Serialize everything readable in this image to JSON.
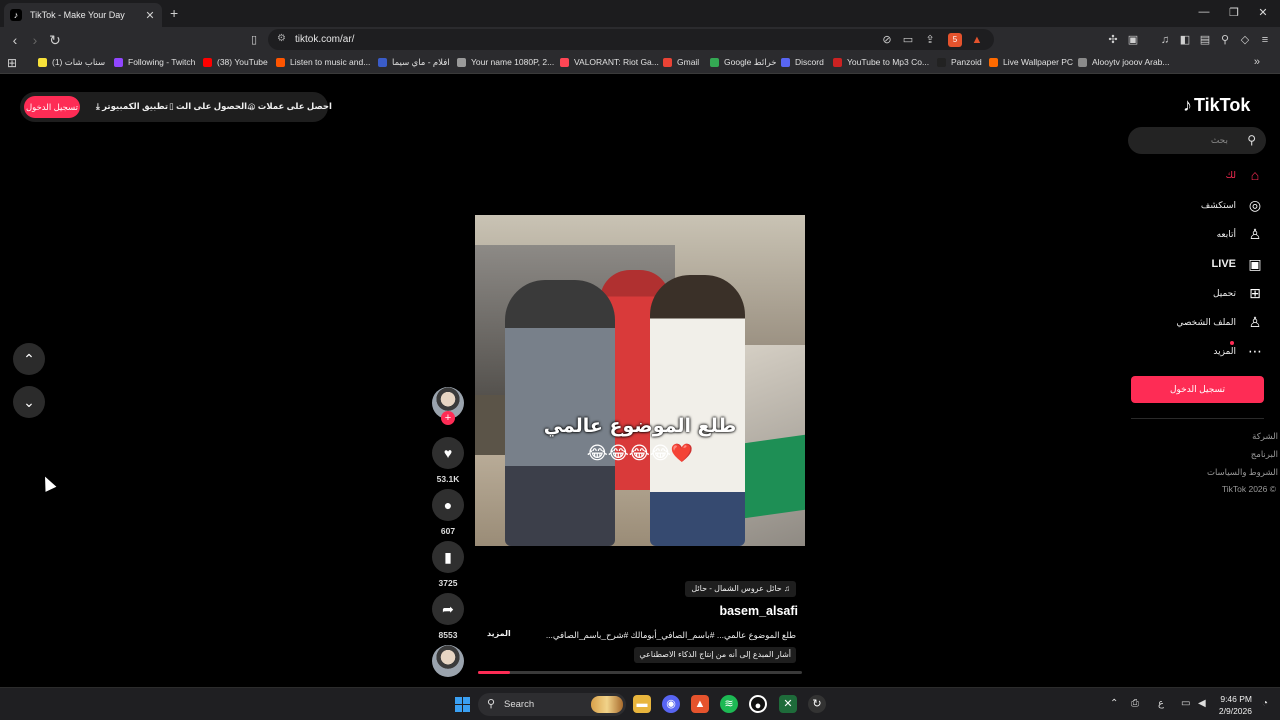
{
  "browser": {
    "tab_title": "TikTok - Make Your Day",
    "tab_close": "✕",
    "new_tab": "+",
    "url": "tiktok.com/ar/",
    "window_controls": {
      "minimize": "—",
      "restore": "❐",
      "close": "✕"
    },
    "shield_badge": "5"
  },
  "bookmarks": [
    {
      "label": "(1) سناب شات",
      "color": "#f7e13a"
    },
    {
      "label": "Following - Twitch",
      "color": "#9146ff"
    },
    {
      "label": "(38) YouTube",
      "color": "#ff0000"
    },
    {
      "label": "Listen to music and...",
      "color": "#ff5500"
    },
    {
      "label": "افلام - ماي سيما",
      "color": "#3a5cc8"
    },
    {
      "label": "Your name 1080P, 2...",
      "color": "#9a9a9a"
    },
    {
      "label": "VALORANT: Riot Ga...",
      "color": "#ff4655"
    },
    {
      "label": "Gmail",
      "color": "#ea4335"
    },
    {
      "label": "Google خرائط",
      "color": "#34a853"
    },
    {
      "label": "Discord",
      "color": "#5865f2"
    },
    {
      "label": "YouTube to Mp3 Co...",
      "color": "#cc2222"
    },
    {
      "label": "Panzoid",
      "color": "#222222"
    },
    {
      "label": "Live Wallpaper PC",
      "color": "#ff6a00"
    },
    {
      "label": "Alooytv jooov Arab...",
      "color": "#8a8a8a"
    }
  ],
  "top_bar": {
    "coins": "احصل على عملات",
    "app": "الحصول على الت...",
    "desktop": "تطبيق الكمبيوتر",
    "login": "تسجيل الدخول"
  },
  "sidebar": {
    "logo": "TikTok",
    "search_placeholder": "بحث",
    "items": [
      {
        "label": "لك",
        "icon": "home-icon"
      },
      {
        "label": "استكشف",
        "icon": "compass-icon"
      },
      {
        "label": "أتابعه",
        "icon": "following-icon"
      },
      {
        "label": "LIVE",
        "icon": "live-icon"
      },
      {
        "label": "تحميل",
        "icon": "upload-icon"
      },
      {
        "label": "الملف الشخصي",
        "icon": "profile-icon"
      },
      {
        "label": "المزيد",
        "icon": "more-icon"
      }
    ],
    "login_button": "تسجيل الدخول",
    "footer": [
      "الشركة",
      "البرنامج",
      "الشروط والسياسات",
      "TikTok 2026 ©"
    ]
  },
  "video": {
    "caption": "طلع الموضوع عالمي",
    "emoji": "❤️😂😂😂😂",
    "likes": "53.1K",
    "comments": "607",
    "saves": "3725",
    "shares": "8553",
    "progress_fraction": 0.1,
    "username": "basem_alsafi",
    "music": "حائل عروس الشمال - حائل",
    "description": "طلع الموضوع عالمي... #باسم_الصافي_أبومالك #شرح_باسم_الصافي...",
    "more_label": "المزيد",
    "ai_label": "أشار المبدع إلى أنه من إنتاج الذكاء الاصطناعي"
  },
  "taskbar": {
    "search": "Search",
    "time": "9:46 PM",
    "date": "2/9/2026",
    "lang": "ع"
  },
  "colors": {
    "accent": "#fe2c55",
    "background": "#000000"
  }
}
